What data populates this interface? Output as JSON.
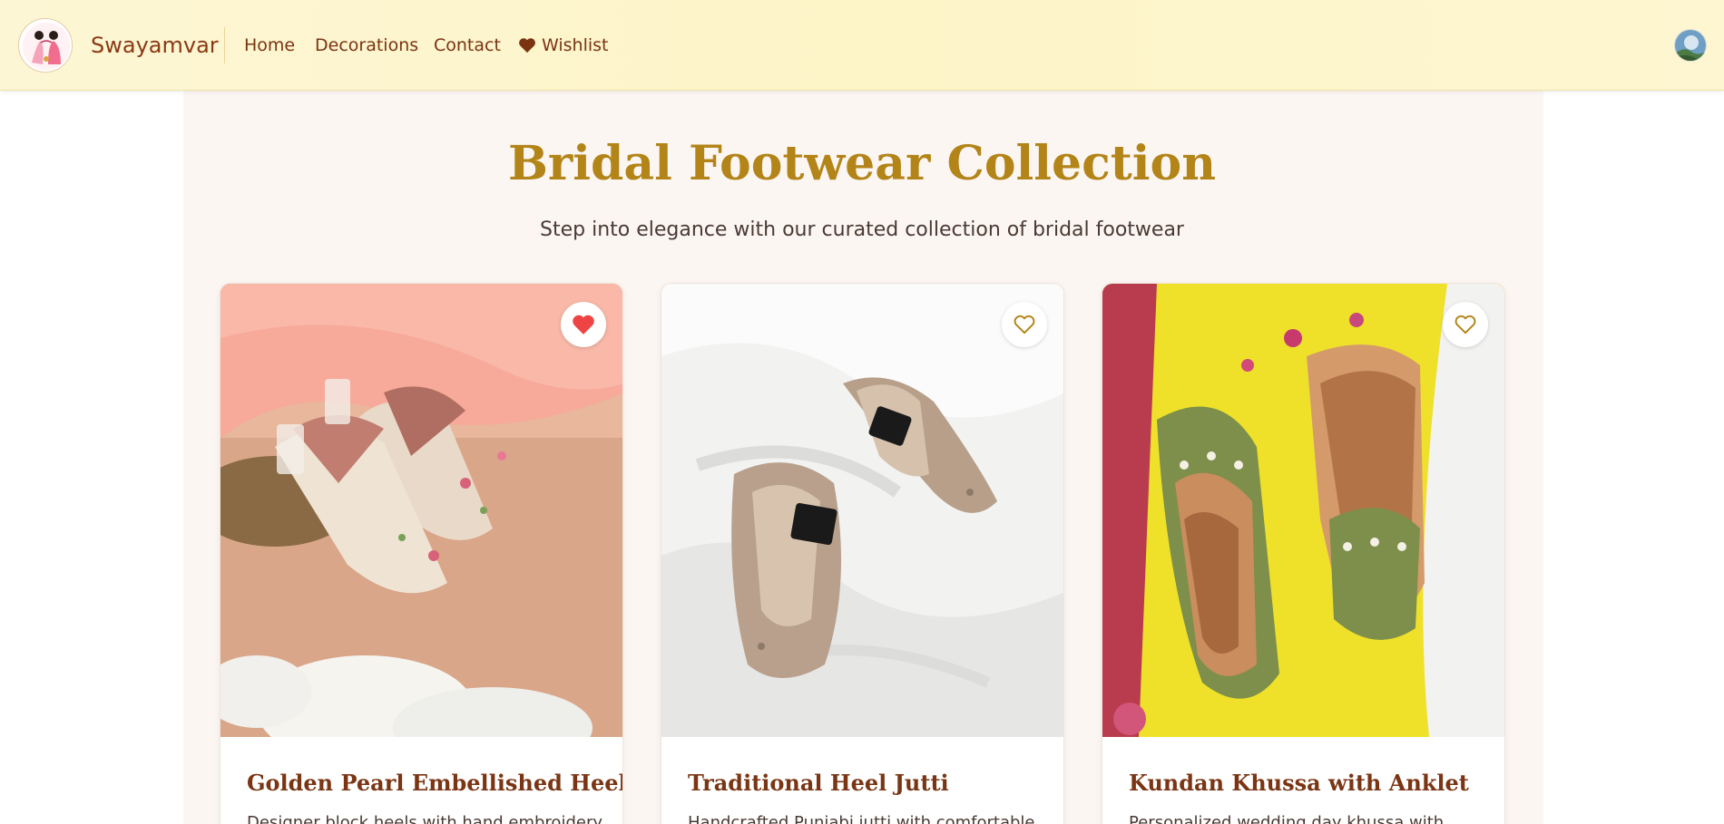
{
  "brand": {
    "name": "Swayamvar"
  },
  "nav": {
    "home": "Home",
    "decorations": "Decorations",
    "contact": "Contact",
    "wishlist": "Wishlist"
  },
  "colors": {
    "accent_gold": "#b38519",
    "brand_brown": "#7a3412",
    "wishlist_active": "#ef4444"
  },
  "page": {
    "title": "Bridal Footwear Collection",
    "subtitle": "Step into elegance with our curated collection of bridal footwear"
  },
  "products": [
    {
      "title": "Golden Pearl Embellished Heels",
      "description": "Designer block heels with hand embroidery",
      "wishlisted": true,
      "icon": "heart-filled-icon"
    },
    {
      "title": "Traditional Heel Jutti",
      "description": "Handcrafted Punjabi jutti with comfortable",
      "wishlisted": false,
      "icon": "heart-outline-icon"
    },
    {
      "title": "Kundan Khussa with Anklet",
      "description": "Personalized wedding day khussa with",
      "wishlisted": false,
      "icon": "heart-outline-icon"
    }
  ]
}
